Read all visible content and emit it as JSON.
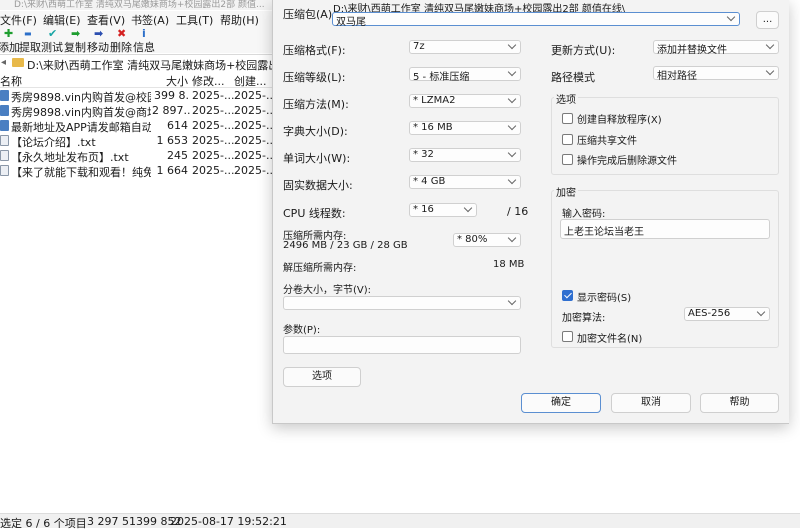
{
  "filemanager": {
    "title": "D:\\来财\\西萌工作室 清纯双马尾嫩妹商场+校园露出2部 颜值...",
    "menu": [
      "文件(F)",
      "编辑(E)",
      "查看(V)",
      "书签(A)",
      "工具(T)",
      "帮助(H)"
    ],
    "toolbar": [
      {
        "label": "添加",
        "icon": "plus-icon",
        "glyph": "✚",
        "color": "#1e9e2f"
      },
      {
        "label": "提取",
        "icon": "minus-icon",
        "glyph": "▬",
        "color": "#2c6fc9"
      },
      {
        "label": "测试",
        "icon": "check-icon",
        "glyph": "✔",
        "color": "#1aa6a6"
      },
      {
        "label": "复制",
        "icon": "copy-arrow-icon",
        "glyph": "➡",
        "color": "#1e9e2f"
      },
      {
        "label": "移动",
        "icon": "move-arrow-icon",
        "glyph": "➡",
        "color": "#2c4fb0"
      },
      {
        "label": "删除",
        "icon": "delete-icon",
        "glyph": "✖",
        "color": "#d42020"
      },
      {
        "label": "信息",
        "icon": "info-icon",
        "glyph": "i",
        "color": "#2c6fc9"
      }
    ],
    "address": "D:\\来财\\西萌工作室 清纯双马尾嫩妹商场+校园露出2部",
    "columns": {
      "name": "名称",
      "size": "大小",
      "modified": "修改...",
      "created": "创建..."
    },
    "rows": [
      {
        "name": "秀房9898.vin内购首发@校园...",
        "size": "399 8...",
        "modified": "2025-...",
        "created": "2025-...",
        "kind": "file"
      },
      {
        "name": "秀房9898.vin内购首发@商场...",
        "size": "2 897...",
        "modified": "2025-...",
        "created": "2025-...",
        "kind": "file"
      },
      {
        "name": "最新地址及APP请发邮箱自动...",
        "size": "614",
        "modified": "2025-...",
        "created": "2025-...",
        "kind": "file"
      },
      {
        "name": "【论坛介绍】.txt",
        "size": "1 653",
        "modified": "2025-...",
        "created": "2025-...",
        "kind": "txt"
      },
      {
        "name": "【永久地址发布页】.txt",
        "size": "245",
        "modified": "2025-...",
        "created": "2025-...",
        "kind": "txt"
      },
      {
        "name": "【来了就能下载和观看！纯免...",
        "size": "1 664",
        "modified": "2025-...",
        "created": "2025-...",
        "kind": "txt"
      }
    ],
    "status": {
      "selection": "选定 6 / 6 个项目",
      "total": "3 297 51399 852",
      "datetime": "2025-08-17 19:52:21"
    }
  },
  "dialog": {
    "archive_label": "压缩包(A):",
    "archive_path": "D:\\来财\\西萌工作室 清纯双马尾嫩妹商场+校园露出2部 颜值在线\\",
    "archive_name": "双马尾",
    "browse_label": "...",
    "format_label": "压缩格式(F):",
    "format_value": "7z",
    "level_label": "压缩等级(L):",
    "level_value": "5 - 标准压缩",
    "method_label": "压缩方法(M):",
    "method_value": "*  LZMA2",
    "dict_label": "字典大小(D):",
    "dict_value": "*  16 MB",
    "word_label": "单词大小(W):",
    "word_value": "*  32",
    "solid_label": "固实数据大小:",
    "solid_value": "*  4 GB",
    "threads_label": "CPU 线程数:",
    "threads_value": "*  16",
    "threads_max": "/ 16",
    "mem_comp_label": "压缩所需内存:",
    "mem_comp_value": "2496 MB / 23 GB / 28 GB",
    "mem_percent": "* 80%",
    "mem_decomp_label": "解压缩所需内存:",
    "mem_decomp_value": "18 MB",
    "split_label": "分卷大小，字节(V):",
    "split_value": "",
    "params_label": "参数(P):",
    "params_value": "",
    "options_button": "选项",
    "update_label": "更新方式(U):",
    "update_value": "添加并替换文件",
    "pathmode_label": "路径模式",
    "pathmode_value": "相对路径",
    "options_group": "选项",
    "opt_sfx": "创建自释放程序(X)",
    "opt_shared": "压缩共享文件",
    "opt_delete": "操作完成后删除源文件",
    "encrypt_group": "加密",
    "password_label": "输入密码:",
    "password_value": "上老王论坛当老王",
    "show_password_label": "显示密码(S)",
    "show_password_checked": true,
    "enc_method_label": "加密算法:",
    "enc_method_value": "AES-256",
    "enc_names_label": "加密文件名(N)",
    "ok": "确定",
    "cancel": "取消",
    "help": "帮助",
    "accent": "#2f6fd0"
  }
}
